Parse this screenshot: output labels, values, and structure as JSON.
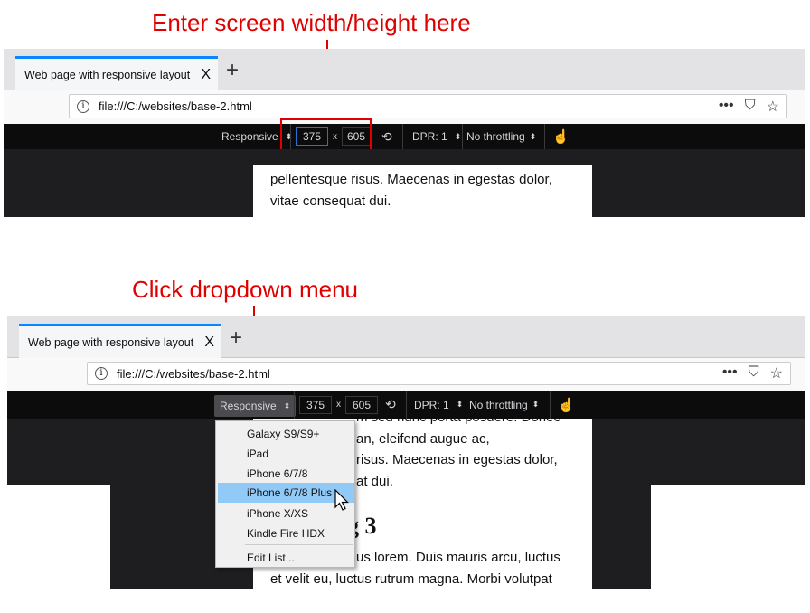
{
  "annotations": {
    "top": "Enter screen width/height here",
    "bottom": "Click dropdown menu"
  },
  "browser": {
    "tab_title": "Web page with responsive layout",
    "close": "X",
    "new_tab": "+",
    "url": "file:///C:/websites/base-2.html",
    "info": "i",
    "more": "•••",
    "pocket": "⛉",
    "bookmark": "☆"
  },
  "toolbar": {
    "device": "Responsive",
    "width": "375",
    "times": "x",
    "height": "605",
    "rotate": "⟲",
    "dpr": "DPR: 1",
    "throttling": "No throttling",
    "touch": "☝",
    "arrows": "⬍"
  },
  "panel1": {
    "lines": [
      "pellentesque risus. Maecenas in egestas dolor,",
      "vitae consequat dui."
    ]
  },
  "panel2": {
    "lines": [
      "m sed nunc porta posuere. Donec",
      "an, eleifend augue ac,",
      "risus. Maecenas in egestas dolor,",
      "at dui."
    ],
    "heading": "g 3",
    "lines2": [
      "us lorem. Duis mauris arcu, luctus",
      "et velit eu, luctus rutrum magna. Morbi volutpat"
    ]
  },
  "dropdown": {
    "items": [
      "Galaxy S9/S9+",
      "iPad",
      "iPhone 6/7/8",
      "iPhone 6/7/8 Plus",
      "iPhone X/XS",
      "Kindle Fire HDX"
    ],
    "selected": "iPhone 6/7/8 Plus",
    "edit": "Edit List..."
  },
  "colors": {
    "annotation": "#e00000",
    "highlight": "#91c9f7",
    "tab_accent": "#0a84ff"
  }
}
